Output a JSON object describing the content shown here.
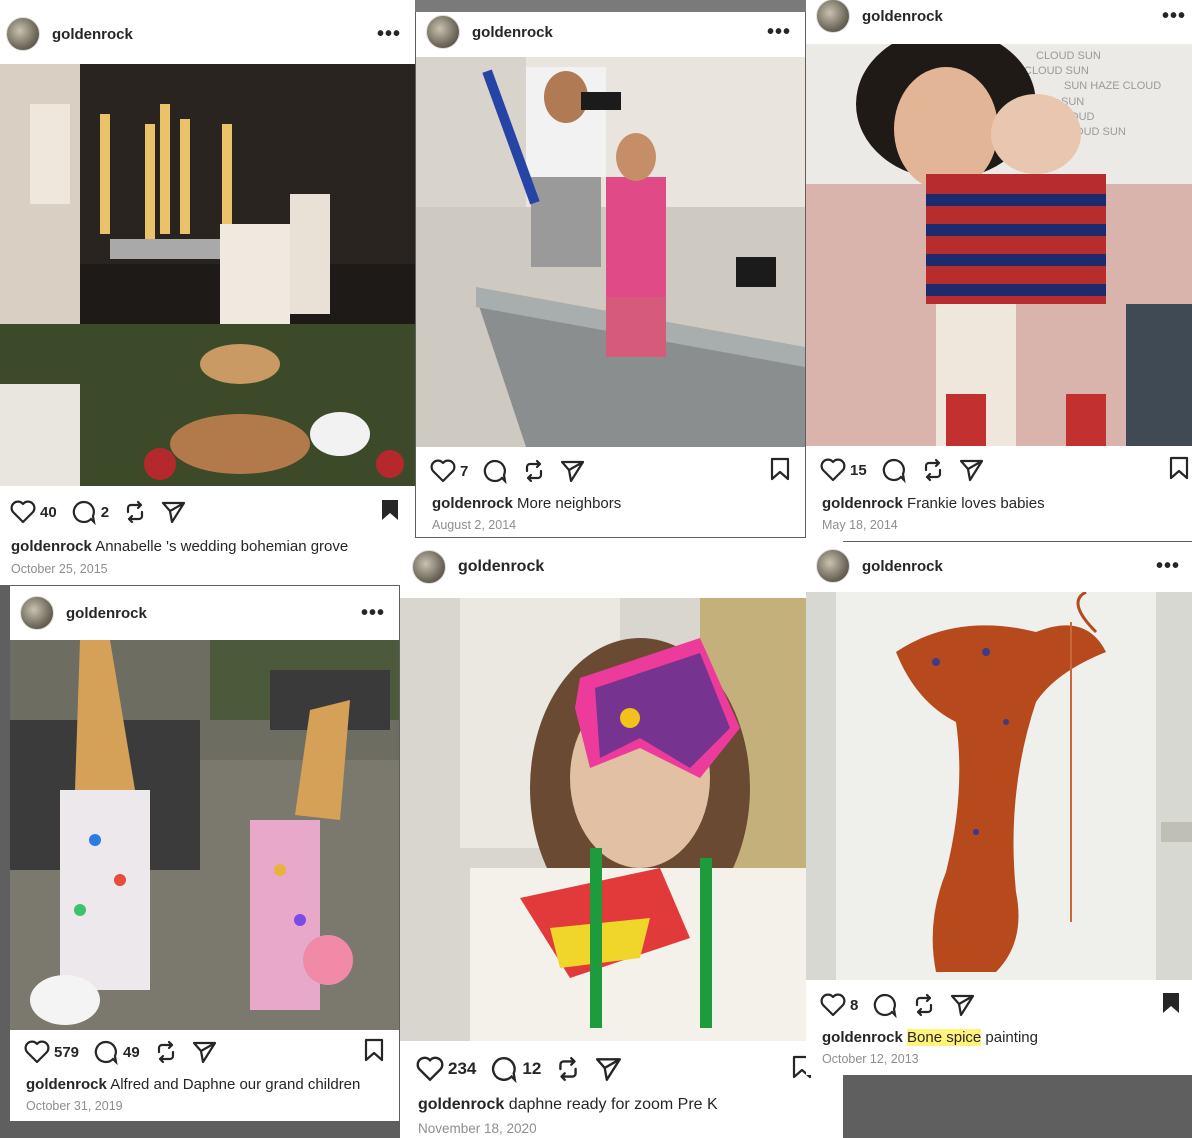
{
  "posts": [
    {
      "username": "goldenrock",
      "likes": "40",
      "comments": "2",
      "caption": "Annabelle 's wedding bohemian grove",
      "date": "October 25, 2015"
    },
    {
      "username": "goldenrock",
      "likes": "7",
      "caption": "More neighbors",
      "date": "August 2, 2014"
    },
    {
      "username": "goldenrock",
      "likes": "15",
      "caption": "Frankie loves babies",
      "date": "May 18, 2014",
      "sign_text": [
        "CLOUD SUN",
        "CLOUD SUN",
        "SUN HAZE CLOUD",
        "SUN",
        "CLOUD",
        "CLOUD SUN"
      ]
    },
    {
      "username": "goldenrock",
      "likes": "579",
      "comments": "49",
      "caption": "Alfred and Daphne our grand children",
      "date": "October 31, 2019"
    },
    {
      "username": "goldenrock",
      "likes": "234",
      "comments": "12",
      "caption": "daphne ready for zoom Pre K",
      "date": "November 18, 2020"
    },
    {
      "username": "goldenrock",
      "likes": "8",
      "caption_highlight": "Bone spice",
      "caption_rest": " painting",
      "date": "October 12, 2013"
    }
  ],
  "icons": [
    "heart-icon",
    "comment-icon",
    "repost-icon",
    "share-icon",
    "bookmark-icon",
    "more-icon"
  ],
  "colors": {
    "background": "#5f5f5f",
    "highlight": "#fff37a",
    "date": "#8e8e8e"
  }
}
